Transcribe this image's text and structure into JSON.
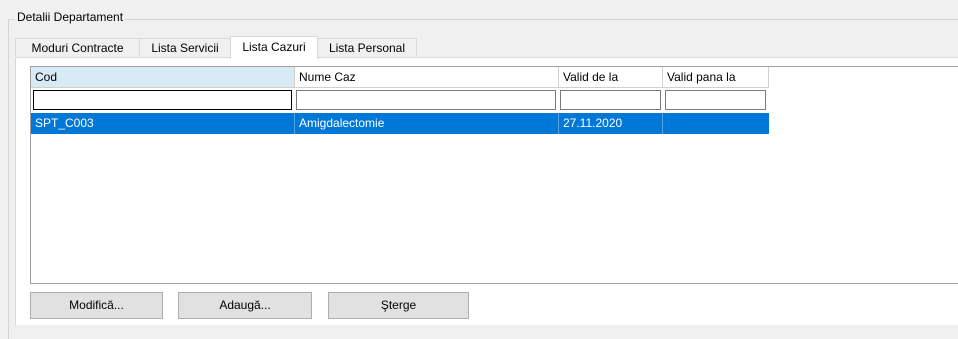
{
  "group": {
    "title": "Detalii Departament"
  },
  "tabs": [
    {
      "label": "Moduri Contracte"
    },
    {
      "label": "Lista Servicii"
    },
    {
      "label": "Lista Cazuri"
    },
    {
      "label": "Lista Personal"
    }
  ],
  "grid": {
    "columns": [
      "Cod",
      "Nume Caz",
      "Valid de la",
      "Valid pana la"
    ],
    "filters": [
      "",
      "",
      "",
      ""
    ],
    "rows": [
      {
        "cod": "SPT_C003",
        "nume": "Amigdalectomie",
        "valid_de_la": "27.11.2020",
        "valid_pana_la": ""
      }
    ]
  },
  "buttons": {
    "modify": "Modifică...",
    "add": "Adaugă...",
    "delete": "Şterge"
  },
  "colors": {
    "selection": "#0078d7",
    "header_active": "#d9eaf7"
  }
}
